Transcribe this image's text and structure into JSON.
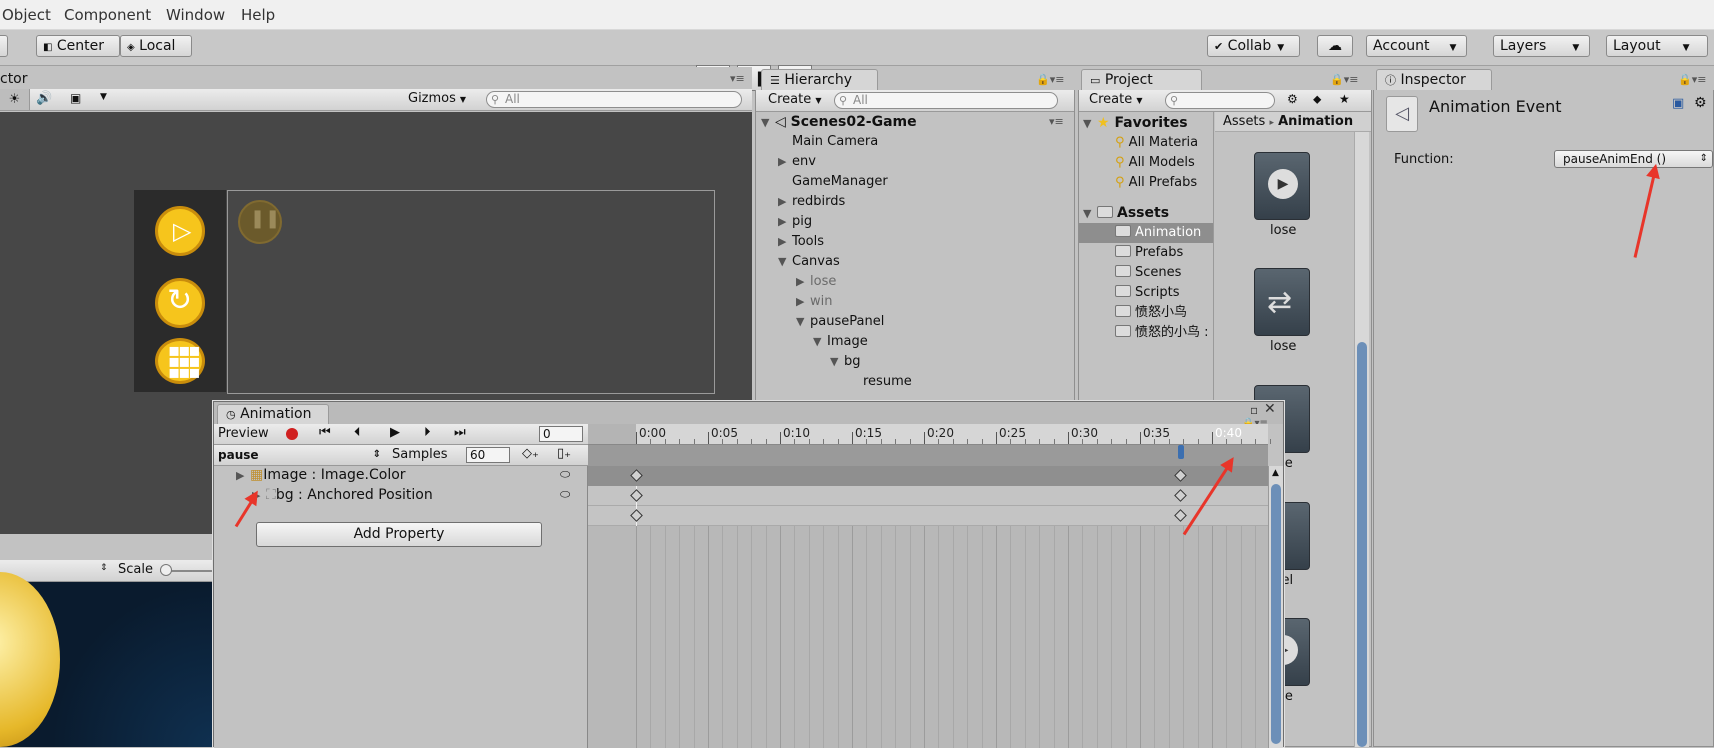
{
  "menu": [
    "Object",
    "Component",
    "Window",
    "Help"
  ],
  "toolbar": {
    "center": "Center",
    "local": "Local",
    "collab": "Collab",
    "account": "Account",
    "layers": "Layers",
    "layout": "Layout"
  },
  "scene": {
    "tab_fragment": "ctor",
    "gizmos": "Gizmos",
    "search_placeholder": "All",
    "scale_label": "Scale"
  },
  "hierarchy": {
    "title": "Hierarchy",
    "create": "Create",
    "search_placeholder": "All",
    "scene_name": "Scenes02-Game",
    "items": [
      "Main Camera",
      "env",
      "GameManager",
      "redbirds",
      "pig",
      "Tools",
      "Canvas",
      "lose",
      "win",
      "pausePanel",
      "Image",
      "bg",
      "resume"
    ]
  },
  "project": {
    "title": "Project",
    "create": "Create",
    "favorites_label": "Favorites",
    "favorites": [
      "All Materia",
      "All Models",
      "All Prefabs"
    ],
    "assets_label": "Assets",
    "folders": [
      "Animation",
      "Prefabs",
      "Scenes",
      "Scripts",
      "愤怒小鸟",
      "愤怒的小鸟 :"
    ],
    "breadcrumb_root": "Assets",
    "breadcrumb_current": "Animation",
    "asset_labels": [
      "lose",
      "lose",
      "ose",
      "Panel",
      "ume"
    ]
  },
  "inspector": {
    "title": "Inspector",
    "component": "Animation Event",
    "function_label": "Function:",
    "function_value": "pauseAnimEnd ()"
  },
  "animation": {
    "title": "Animation",
    "preview": "Preview",
    "frame_value": "0",
    "clip_name": "pause",
    "samples_label": "Samples",
    "samples_value": "60",
    "ruler_labels": [
      "0:00",
      "0:05",
      "0:10",
      "0:15",
      "0:20",
      "0:25",
      "0:30",
      "0:35",
      "0:40"
    ],
    "properties": [
      {
        "label": "Image : Image.Color"
      },
      {
        "label": "bg : Anchored Position"
      }
    ],
    "add_property": "Add Property"
  },
  "colors": {
    "accent": "#3c6fb0",
    "record": "#d02020",
    "arrow": "#e8352a",
    "button_yellow": "#f6c51c"
  }
}
